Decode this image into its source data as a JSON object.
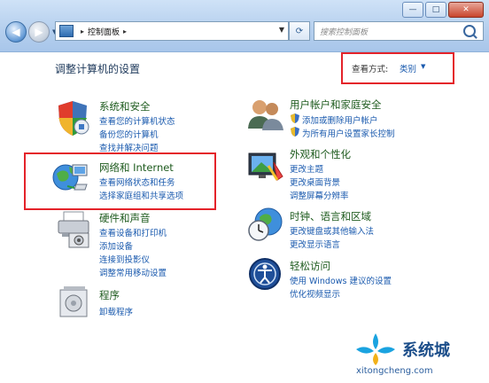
{
  "toolbar": {
    "breadcrumb_separator": "▸",
    "breadcrumb": "控制面板",
    "search_placeholder": "搜索控制面板"
  },
  "window_buttons": {
    "minimize": "—",
    "maximize": "□",
    "close": "✕"
  },
  "header": {
    "title": "调整计算机的设置",
    "view_label": "查看方式:",
    "view_value": "类别"
  },
  "categories": {
    "system": {
      "title": "系统和安全",
      "links": [
        "查看您的计算机状态",
        "备份您的计算机",
        "查找并解决问题"
      ]
    },
    "network": {
      "title": "网络和 Internet",
      "links": [
        "查看网络状态和任务",
        "选择家庭组和共享选项"
      ]
    },
    "hardware": {
      "title": "硬件和声音",
      "links": [
        "查看设备和打印机",
        "添加设备",
        "连接到投影仪",
        "调整常用移动设置"
      ]
    },
    "programs": {
      "title": "程序",
      "links": [
        "卸载程序"
      ]
    },
    "users": {
      "title": "用户帐户和家庭安全",
      "links": [
        "添加或删除用户帐户",
        "为所有用户设置家长控制"
      ]
    },
    "appearance": {
      "title": "外观和个性化",
      "links": [
        "更改主题",
        "更改桌面背景",
        "调整屏幕分辨率"
      ]
    },
    "clock": {
      "title": "时钟、语言和区域",
      "links": [
        "更改键盘或其他输入法",
        "更改显示语言"
      ]
    },
    "ease": {
      "title": "轻松访问",
      "links": [
        "使用 Windows 建议的设置",
        "优化视频显示"
      ]
    }
  },
  "watermark": {
    "name": "系统城",
    "url": "xitongcheng.com"
  },
  "colors": {
    "highlight_box": "#e4232a",
    "link": "#1a5aae",
    "category_title": "#1e5b1e"
  }
}
